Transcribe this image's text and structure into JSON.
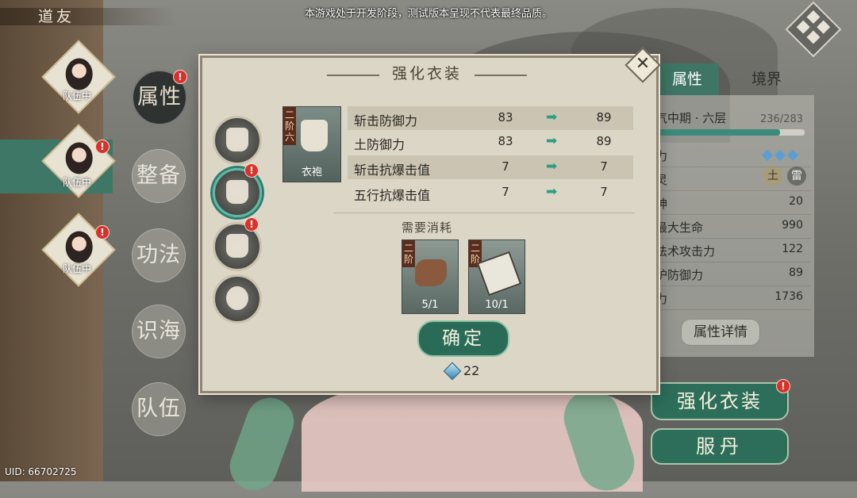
{
  "notice": "本游戏处于开发阶段，测试版本呈现不代表最终品质。",
  "uid": "UID: 66702725",
  "sidebar": {
    "title": "道友",
    "friends": [
      {
        "status": "队伍中",
        "badge": ""
      },
      {
        "status": "队伍中",
        "badge": "!"
      },
      {
        "status": "队伍中",
        "badge": "!"
      }
    ]
  },
  "menu": [
    {
      "label": "属性",
      "badge": "!"
    },
    {
      "label": "整备"
    },
    {
      "label": "功法"
    },
    {
      "label": "识海"
    },
    {
      "label": "队伍"
    }
  ],
  "modal": {
    "title": "强化衣装",
    "close_glyph": "✕",
    "slot_badge": "!",
    "item": {
      "tier": "二阶六",
      "name": "衣袍"
    },
    "stats": [
      {
        "name": "斩击防御力",
        "before": "83",
        "after": "89"
      },
      {
        "name": "土防御力",
        "before": "83",
        "after": "89"
      },
      {
        "name": "斩击抗爆击值",
        "before": "7",
        "after": "7"
      },
      {
        "name": "五行抗爆击值",
        "before": "7",
        "after": "7"
      }
    ],
    "need_label": "需要消耗",
    "materials": [
      {
        "tier": "二阶",
        "count": "5/1"
      },
      {
        "tier": "二阶",
        "count": "10/1"
      }
    ],
    "confirm_label": "确定",
    "cost": "22"
  },
  "right_panel": {
    "tabs": [
      "属性",
      "境界"
    ],
    "realm": "气中期 · 六层",
    "exp": "236/283",
    "exp_fraction": 0.834,
    "element_tags": [
      "土",
      "雷"
    ],
    "rows": [
      {
        "key": "力",
        "value": ""
      },
      {
        "key": "灵",
        "value": ""
      },
      {
        "key": "神",
        "value": "20"
      },
      {
        "key": "最大生命",
        "value": "990"
      },
      {
        "key": "法术攻击力",
        "value": "122"
      },
      {
        "key": "护防御力",
        "value": "89"
      },
      {
        "key": "力",
        "value": "1736"
      }
    ],
    "detail_button": "属性详情",
    "enhance_button": "强化衣装",
    "enhance_badge": "!",
    "pill_button": "服丹"
  }
}
